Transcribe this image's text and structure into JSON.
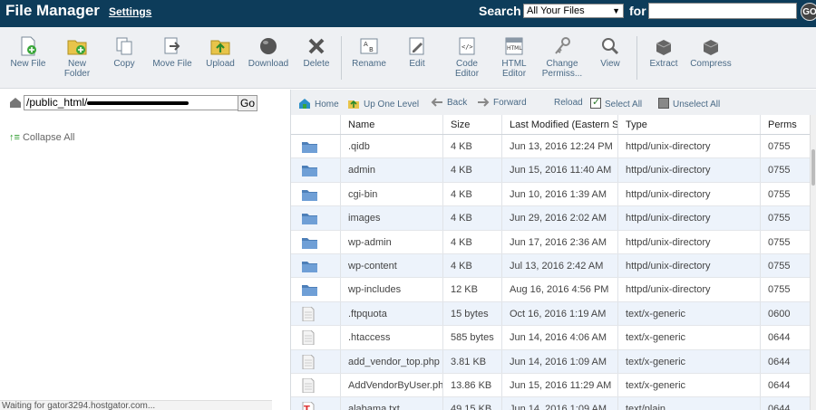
{
  "header": {
    "title": "File Manager",
    "settings": "Settings",
    "search_label": "Search",
    "search_scope": "All Your Files",
    "for_label": "for",
    "search_value": "",
    "go": "GO"
  },
  "toolbar": [
    {
      "name": "new-file",
      "label": "New File",
      "icon": "new-file-icon"
    },
    {
      "name": "new-folder",
      "label": "New\nFolder",
      "icon": "new-folder-icon"
    },
    {
      "name": "copy",
      "label": "Copy",
      "icon": "copy-icon"
    },
    {
      "name": "move-file",
      "label": "Move File",
      "icon": "move-icon"
    },
    {
      "name": "upload",
      "label": "Upload",
      "icon": "upload-icon"
    },
    {
      "name": "download",
      "label": "Download",
      "icon": "download-icon"
    },
    {
      "name": "delete",
      "label": "Delete",
      "icon": "delete-icon"
    },
    {
      "name": "rename",
      "label": "Rename",
      "icon": "rename-icon"
    },
    {
      "name": "edit",
      "label": "Edit",
      "icon": "edit-icon"
    },
    {
      "name": "code-editor",
      "label": "Code\nEditor",
      "icon": "code-editor-icon"
    },
    {
      "name": "html-editor",
      "label": "HTML\nEditor",
      "icon": "html-editor-icon"
    },
    {
      "name": "change-permissions",
      "label": "Change\nPermiss...",
      "icon": "key-icon"
    },
    {
      "name": "view",
      "label": "View",
      "icon": "magnifier-icon"
    },
    {
      "name": "extract",
      "label": "Extract",
      "icon": "extract-icon"
    },
    {
      "name": "compress",
      "label": "Compress",
      "icon": "compress-icon"
    }
  ],
  "left": {
    "path": "/public_html/",
    "go": "Go",
    "collapse_all": "Collapse All",
    "status": "Waiting for gator3294.hostgator.com..."
  },
  "nav": {
    "home": "Home",
    "up_one_level": "Up One Level",
    "back": "Back",
    "forward": "Forward",
    "reload": "Reload",
    "select_all": "Select All",
    "unselect_all": "Unselect All"
  },
  "columns": [
    "Name",
    "Size",
    "Last Modified (Eastern St",
    "Type",
    "Perms"
  ],
  "files": [
    {
      "kind": "folder",
      "name": ".qidb",
      "size": "4 KB",
      "modified": "Jun 13, 2016 12:24 PM",
      "type": "httpd/unix-directory",
      "perms": "0755"
    },
    {
      "kind": "folder",
      "name": "admin",
      "size": "4 KB",
      "modified": "Jun 15, 2016 11:40 AM",
      "type": "httpd/unix-directory",
      "perms": "0755"
    },
    {
      "kind": "folder",
      "name": "cgi-bin",
      "size": "4 KB",
      "modified": "Jun 10, 2016 1:39 AM",
      "type": "httpd/unix-directory",
      "perms": "0755"
    },
    {
      "kind": "folder",
      "name": "images",
      "size": "4 KB",
      "modified": "Jun 29, 2016 2:02 AM",
      "type": "httpd/unix-directory",
      "perms": "0755"
    },
    {
      "kind": "folder",
      "name": "wp-admin",
      "size": "4 KB",
      "modified": "Jun 17, 2016 2:36 AM",
      "type": "httpd/unix-directory",
      "perms": "0755"
    },
    {
      "kind": "folder",
      "name": "wp-content",
      "size": "4 KB",
      "modified": "Jul 13, 2016 2:42 AM",
      "type": "httpd/unix-directory",
      "perms": "0755"
    },
    {
      "kind": "folder",
      "name": "wp-includes",
      "size": "12 KB",
      "modified": "Aug 16, 2016 4:56 PM",
      "type": "httpd/unix-directory",
      "perms": "0755"
    },
    {
      "kind": "file",
      "name": ".ftpquota",
      "size": "15 bytes",
      "modified": "Oct 16, 2016 1:19 AM",
      "type": "text/x-generic",
      "perms": "0600"
    },
    {
      "kind": "file",
      "name": ".htaccess",
      "size": "585 bytes",
      "modified": "Jun 14, 2016 4:06 AM",
      "type": "text/x-generic",
      "perms": "0644"
    },
    {
      "kind": "file",
      "name": "add_vendor_top.php",
      "size": "3.81 KB",
      "modified": "Jun 14, 2016 1:09 AM",
      "type": "text/x-generic",
      "perms": "0644"
    },
    {
      "kind": "file",
      "name": "AddVendorByUser.php",
      "size": "13.86 KB",
      "modified": "Jun 15, 2016 11:29 AM",
      "type": "text/x-generic",
      "perms": "0644"
    },
    {
      "kind": "text",
      "name": "alabama.txt",
      "size": "49.15 KB",
      "modified": "Jun 14, 2016 1:09 AM",
      "type": "text/plain",
      "perms": "0644"
    }
  ],
  "colors": {
    "header_bg": "#0d3c5a",
    "toolbar_bg": "#eef0f3",
    "row_alt": "#edf3fb",
    "link": "#4a6a86"
  }
}
